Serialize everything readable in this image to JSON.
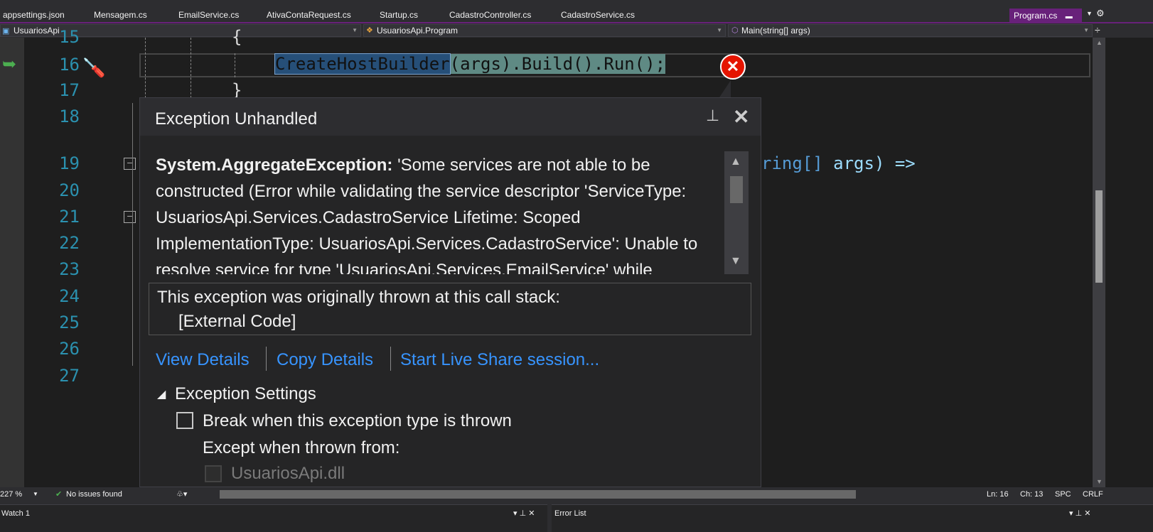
{
  "tabs": [
    "appsettings.json",
    "Mensagem.cs",
    "EmailService.cs",
    "AtivaContaRequest.cs",
    "Startup.cs",
    "CadastroController.cs",
    "CadastroService.cs"
  ],
  "active_tab": "Program.cs",
  "nav": {
    "project": "UsuariosApi",
    "class": "UsuariosApi.Program",
    "member": "Main(string[] args)"
  },
  "editor": {
    "line_numbers": [
      "15",
      "16",
      "17",
      "18",
      "19",
      "20",
      "21",
      "22",
      "23",
      "24",
      "25",
      "26",
      "27"
    ],
    "line15": "{",
    "line16_selected": "CreateHostBuilder",
    "line16_rest": "(args).Build().Run();",
    "line17": "}",
    "line19_tail_type": "ring[]",
    "line19_tail": " args) =>"
  },
  "exception": {
    "title": "Exception Unhandled",
    "type": "System.AggregateException:",
    "message": "'Some services are not able to be constructed (Error while validating the service descriptor 'ServiceType: UsuariosApi.Services.CadastroService Lifetime: Scoped ImplementationType: UsuariosApi.Services.CadastroService': Unable to resolve service for type 'UsuariosApi.Services.EmailService' while attempting to activate",
    "callstack_label": "This exception was originally thrown at this call stack:",
    "callstack_item": "[External Code]",
    "links": [
      "View Details",
      "Copy Details",
      "Start Live Share session..."
    ],
    "settings_label": "Exception Settings",
    "break_label": "Break when this exception type is thrown",
    "except_label": "Except when thrown from:",
    "module": "UsuariosApi.dll",
    "break_checked": false
  },
  "status": {
    "zoom": "227 %",
    "issues": "No issues found",
    "ln": "Ln: 16",
    "ch": "Ch: 13",
    "spc": "SPC",
    "crlf": "CRLF"
  },
  "panels": {
    "left": "Watch 1",
    "right": "Error List"
  },
  "colors": {
    "accent": "#68217a",
    "line_number": "#2b91af",
    "link": "#3794ff",
    "error": "#e51400"
  }
}
